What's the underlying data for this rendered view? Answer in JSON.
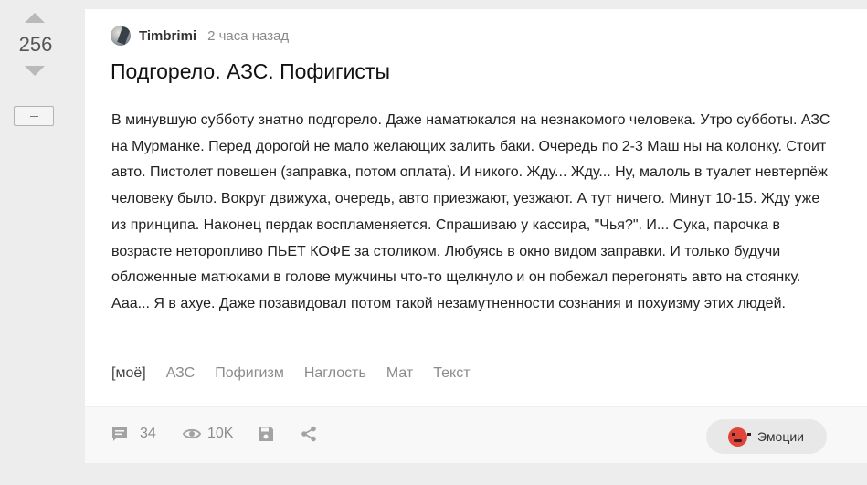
{
  "vote": {
    "rating": "256"
  },
  "story": {
    "author": "Timbrimi",
    "time": "2 часа назад",
    "title": "Подгорело. АЗС. Пофигисты",
    "body": "В минувшую субботу знатно подгорело. Даже наматюкался на незнакомого человека. Утро субботы. АЗС на Мурманке. Перед дорогой не мало желающих залить баки. Очередь по 2-3 Маш ны на колонку. Стоит авто. Пистолет повешен (заправка, потом оплата). И никого. Жду... Жду... Ну, малоль в туалет невтерпёж человеку было. Вокруг движуха, очередь, авто приезжают, уезжают. А тут ничего. Минут 10-15. Жду уже из принципа. Наконец пердак воспламеняется. Спрашиваю у кассира, \"Чья?\". И... Сука, парочка в возрасте неторопливо ПЬЕТ КОФЕ за столиком. Любуясь в окно видом заправки. И только будучи обложенные матюками в голове мужчины что-то щелкнуло и он побежал перегонять авто на стоянку. Ааа... Я в ахуе. Даже позавидовал потом такой незамутненности сознания и похуизму этих людей.",
    "tags": [
      "[моё]",
      "АЗС",
      "Пофигизм",
      "Наглость",
      "Мат",
      "Текст"
    ]
  },
  "footer": {
    "comments_count": "34",
    "views_count": "10K",
    "emotions_label": "Эмоции"
  },
  "icons": {
    "upvote": "arrow-up-icon",
    "downvote": "arrow-down-icon",
    "collapse": "minus-icon",
    "comments": "comment-icon",
    "views": "eye-icon",
    "save": "save-icon",
    "share": "share-icon",
    "emotions": "angry-face-icon"
  },
  "colors": {
    "page_bg": "#ededed",
    "card_bg": "#ffffff",
    "footer_bg": "#f8f8f8",
    "muted": "#8c8c8c",
    "emotion_red": "#e0453a"
  }
}
